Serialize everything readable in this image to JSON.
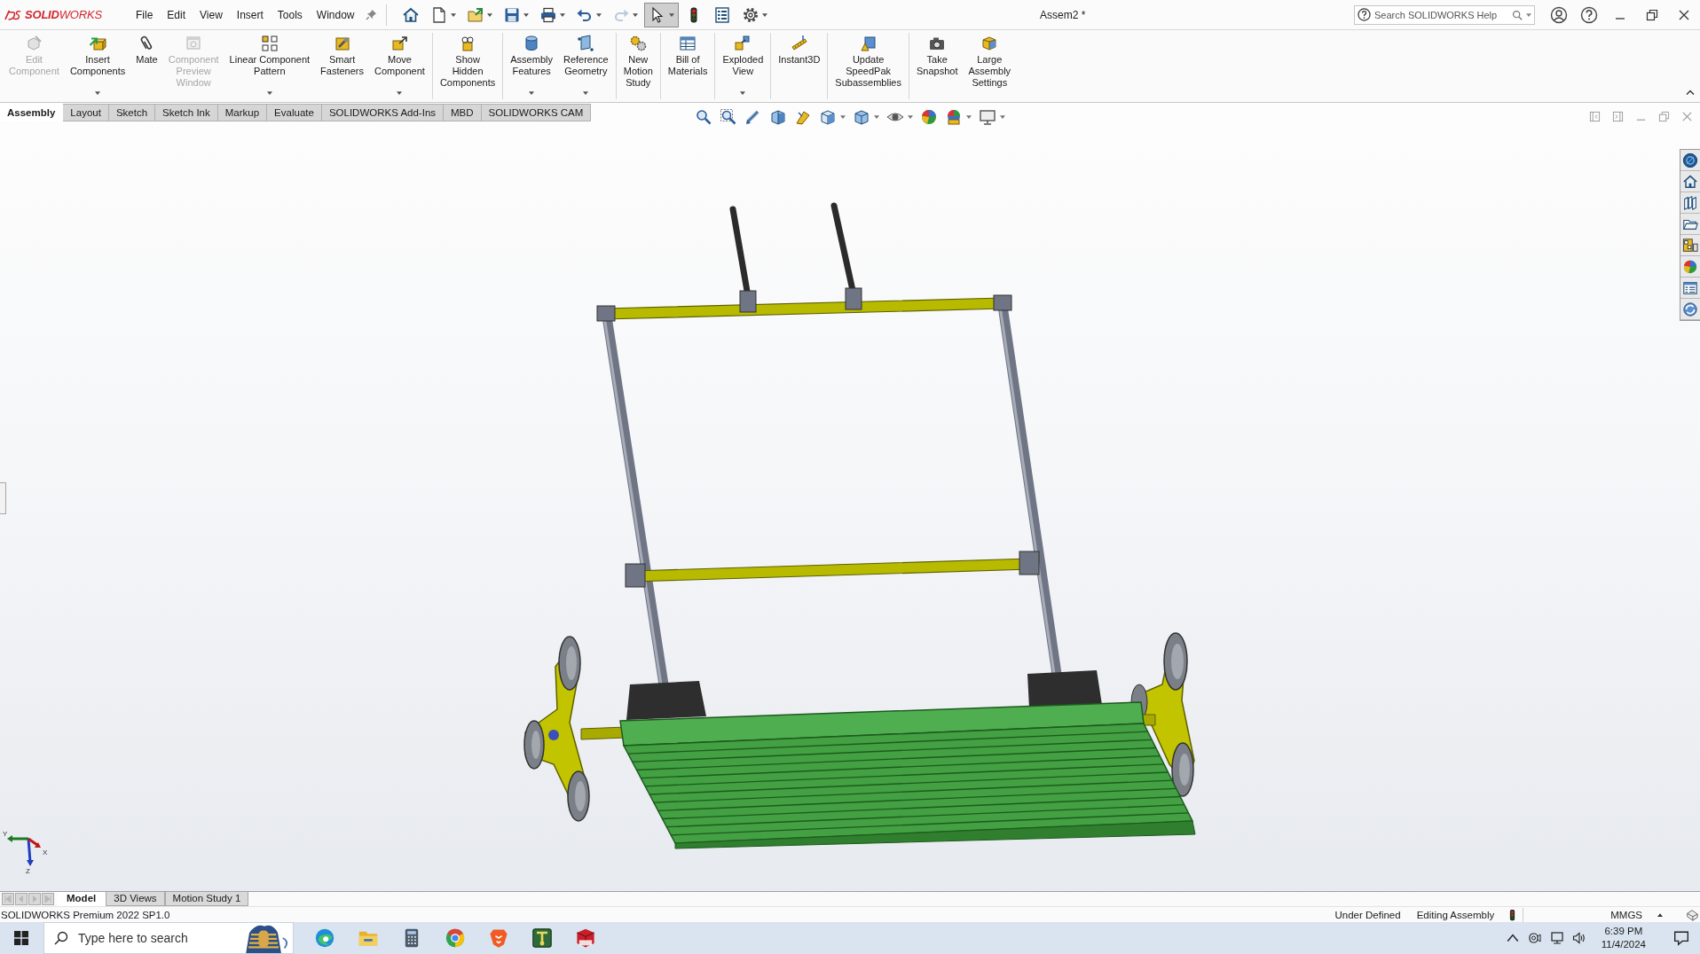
{
  "title_bar": {
    "logo": "**SOLID**WORKS",
    "menu": [
      "File",
      "Edit",
      "View",
      "Insert",
      "Tools",
      "Window"
    ],
    "quick_access": [
      {
        "kind": "home",
        "dropdown": false,
        "disabled": false,
        "selected": false
      },
      {
        "kind": "new",
        "dropdown": true,
        "disabled": false,
        "selected": false
      },
      {
        "kind": "open",
        "dropdown": true,
        "disabled": false,
        "selected": false
      },
      {
        "kind": "save",
        "dropdown": true,
        "disabled": false,
        "selected": false
      },
      {
        "kind": "print",
        "dropdown": true,
        "disabled": false,
        "selected": false
      },
      {
        "kind": "undo",
        "dropdown": true,
        "disabled": false,
        "selected": false
      },
      {
        "kind": "redo",
        "dropdown": true,
        "disabled": true,
        "selected": false
      },
      {
        "kind": "select",
        "dropdown": true,
        "disabled": false,
        "selected": true
      },
      {
        "kind": "rebuild",
        "dropdown": false,
        "disabled": false,
        "selected": false
      },
      {
        "kind": "file-properties",
        "dropdown": false,
        "disabled": false,
        "selected": false
      },
      {
        "kind": "options",
        "dropdown": true,
        "disabled": false,
        "selected": false
      }
    ],
    "document_title": "Assem2 *",
    "search": {
      "placeholder": "Search SOLIDWORKS Help"
    }
  },
  "ribbon": {
    "groups": [
      {
        "buttons": [
          {
            "label": "Edit\nComponent",
            "kind": "edit-component",
            "disabled": true,
            "dropdown": false
          },
          {
            "label": "Insert\nComponents",
            "kind": "insert-components",
            "disabled": false,
            "dropdown": true
          },
          {
            "label": "Mate",
            "kind": "mate",
            "disabled": false,
            "dropdown": false
          },
          {
            "label": "Component\nPreview\nWindow",
            "kind": "component-preview",
            "disabled": true,
            "dropdown": false
          },
          {
            "label": "Linear Component\nPattern",
            "kind": "linear-pattern",
            "disabled": false,
            "dropdown": true
          },
          {
            "label": "Smart\nFasteners",
            "kind": "smart-fasteners",
            "disabled": false,
            "dropdown": false
          },
          {
            "label": "Move\nComponent",
            "kind": "move-component",
            "disabled": false,
            "dropdown": true
          }
        ]
      },
      {
        "buttons": [
          {
            "label": "Show\nHidden\nComponents",
            "kind": "show-hidden",
            "disabled": false,
            "dropdown": false
          }
        ]
      },
      {
        "buttons": [
          {
            "label": "Assembly\nFeatures",
            "kind": "assembly-features",
            "disabled": false,
            "dropdown": true
          },
          {
            "label": "Reference\nGeometry",
            "kind": "reference-geometry",
            "disabled": false,
            "dropdown": true
          }
        ]
      },
      {
        "buttons": [
          {
            "label": "New\nMotion\nStudy",
            "kind": "motion-study",
            "disabled": false,
            "dropdown": false
          }
        ]
      },
      {
        "buttons": [
          {
            "label": "Bill of\nMaterials",
            "kind": "bom",
            "disabled": false,
            "dropdown": false
          }
        ]
      },
      {
        "buttons": [
          {
            "label": "Exploded\nView",
            "kind": "exploded-view",
            "disabled": false,
            "dropdown": true
          }
        ]
      },
      {
        "buttons": [
          {
            "label": "Instant3D",
            "kind": "instant3d",
            "disabled": false,
            "dropdown": false
          }
        ]
      },
      {
        "buttons": [
          {
            "label": "Update\nSpeedPak\nSubassemblies",
            "kind": "speedpak",
            "disabled": false,
            "dropdown": false
          }
        ]
      },
      {
        "buttons": [
          {
            "label": "Take\nSnapshot",
            "kind": "snapshot",
            "disabled": false,
            "dropdown": false
          },
          {
            "label": "Large\nAssembly\nSettings",
            "kind": "large-assembly",
            "disabled": false,
            "dropdown": false
          }
        ]
      }
    ]
  },
  "command_tabs": [
    {
      "label": "Assembly",
      "selected": true
    },
    {
      "label": "Layout",
      "selected": false
    },
    {
      "label": "Sketch",
      "selected": false
    },
    {
      "label": "Sketch Ink",
      "selected": false
    },
    {
      "label": "Markup",
      "selected": false
    },
    {
      "label": "Evaluate",
      "selected": false
    },
    {
      "label": "SOLIDWORKS Add-Ins",
      "selected": false
    },
    {
      "label": "MBD",
      "selected": false
    },
    {
      "label": "SOLIDWORKS CAM",
      "selected": false
    }
  ],
  "heads_up_toolbar": [
    {
      "kind": "zoom-fit",
      "dropdown": false
    },
    {
      "kind": "zoom-area",
      "dropdown": false
    },
    {
      "kind": "previous-view",
      "dropdown": false
    },
    {
      "kind": "section-view",
      "dropdown": false
    },
    {
      "kind": "dynamic-annotation",
      "dropdown": false
    },
    {
      "kind": "view-orientation",
      "dropdown": true
    },
    {
      "kind": "display-style",
      "dropdown": true
    },
    {
      "kind": "hide-show",
      "dropdown": true
    },
    {
      "kind": "edit-appearance",
      "dropdown": false
    },
    {
      "kind": "apply-scene",
      "dropdown": true
    },
    {
      "kind": "view-settings",
      "dropdown": true
    }
  ],
  "task_pane": [
    {
      "kind": "globe"
    },
    {
      "kind": "home"
    },
    {
      "kind": "library"
    },
    {
      "kind": "folder"
    },
    {
      "kind": "view-palette"
    },
    {
      "kind": "edit-appearance"
    },
    {
      "kind": "custom-properties"
    },
    {
      "kind": "sync"
    }
  ],
  "graphics": {
    "triad": [
      "Y",
      "X",
      "Z"
    ]
  },
  "bottom_tabs": [
    {
      "label": "Model",
      "selected": true
    },
    {
      "label": "3D Views",
      "selected": false
    },
    {
      "label": "Motion Study 1",
      "selected": false
    }
  ],
  "status_bar": {
    "product": "SOLIDWORKS Premium 2022 SP1.0",
    "definition": "Under Defined",
    "mode": "Editing Assembly",
    "units": "MMGS"
  },
  "taskbar": {
    "search": {
      "placeholder": "Type here to search"
    },
    "apps": [
      {
        "kind": "edge"
      },
      {
        "kind": "explorer"
      },
      {
        "kind": "calculator"
      },
      {
        "kind": "chrome"
      },
      {
        "kind": "brave"
      },
      {
        "kind": "green-app"
      },
      {
        "kind": "sw-app"
      }
    ],
    "time": "6:39 PM",
    "date": "11/4/2024"
  }
}
